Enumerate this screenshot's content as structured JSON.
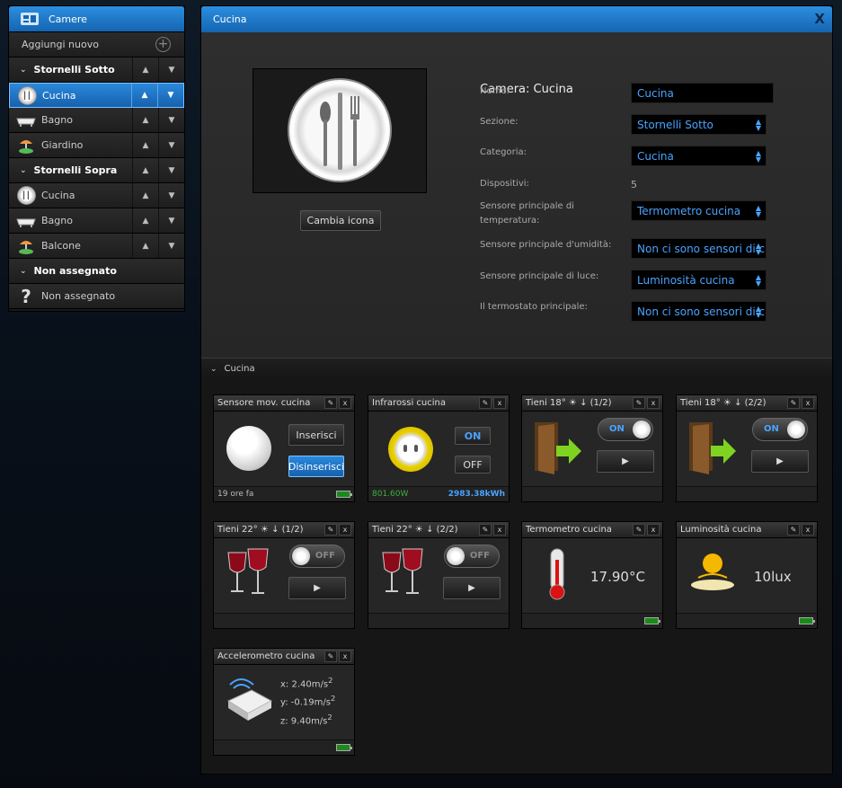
{
  "sidebar": {
    "title": "Camere",
    "add_label": "Aggiungi nuovo",
    "sections": [
      {
        "label": "Stornelli Sotto",
        "rooms": [
          {
            "label": "Cucina",
            "icon": "plate-icon",
            "selected": true
          },
          {
            "label": "Bagno",
            "icon": "bathtub-icon"
          },
          {
            "label": "Giardino",
            "icon": "garden-icon"
          }
        ]
      },
      {
        "label": "Stornelli Sopra",
        "rooms": [
          {
            "label": "Cucina",
            "icon": "plate-icon"
          },
          {
            "label": "Bagno",
            "icon": "bathtub-icon"
          },
          {
            "label": "Balcone",
            "icon": "garden-icon"
          }
        ]
      },
      {
        "label": "Non assegnato",
        "rooms": [
          {
            "label": "Non assegnato",
            "icon": "question-icon"
          }
        ]
      }
    ]
  },
  "main": {
    "title": "Cucina",
    "close": "X",
    "change_icon": "Cambia icona",
    "form_title": "Camera: Cucina",
    "fields": {
      "nome": {
        "label": "Nome:",
        "value": "Cucina"
      },
      "sezione": {
        "label": "Sezione:",
        "value": "Stornelli Sotto"
      },
      "categoria": {
        "label": "Categoria:",
        "value": "Cucina"
      },
      "dispositivi": {
        "label": "Dispositivi:",
        "value": "5"
      },
      "temp": {
        "label": "Sensore principale di temperatura:",
        "value": "Termometro cucina"
      },
      "umid": {
        "label": "Sensore principale d'umidità:",
        "value": "Non ci sono sensori di c"
      },
      "luce": {
        "label": "Sensore principale di luce:",
        "value": "Luminosità cucina"
      },
      "termo": {
        "label": "Il termostato principale:",
        "value": "Non ci sono sensori di c"
      }
    },
    "section_label": "Cucina"
  },
  "widgets": {
    "motion": {
      "title": "Sensore mov. cucina",
      "arm": "Inserisci",
      "disarm": "Disinserisci",
      "footer": "19 ore fa"
    },
    "ir": {
      "title": "Infrarossi cucina",
      "on": "ON",
      "off": "OFF",
      "power": "801.60W",
      "energy": "2983.38kWh"
    },
    "scene1": {
      "title": "Tieni 18° ☀ ↓ (1/2)",
      "state": "ON"
    },
    "scene2": {
      "title": "Tieni 18° ☀ ↓ (2/2)",
      "state": "ON"
    },
    "scene3": {
      "title": "Tieni 22° ☀ ↓ (1/2)",
      "state": "OFF"
    },
    "scene4": {
      "title": "Tieni 22° ☀ ↓ (2/2)",
      "state": "OFF"
    },
    "thermo": {
      "title": "Termometro cucina",
      "value": "17.90",
      "unit": "°C"
    },
    "lux": {
      "title": "Luminosità cucina",
      "value": "10lux"
    },
    "accel": {
      "title": "Accelerometro cucina",
      "x": "x: 2.40m/s",
      "y": "y: -0.19m/s",
      "z": "z: 9.40m/s",
      "exp": "2"
    }
  },
  "colors": {
    "accent": "#1f7bd0",
    "on": "#4aa3ff",
    "power": "#3fae3f"
  }
}
